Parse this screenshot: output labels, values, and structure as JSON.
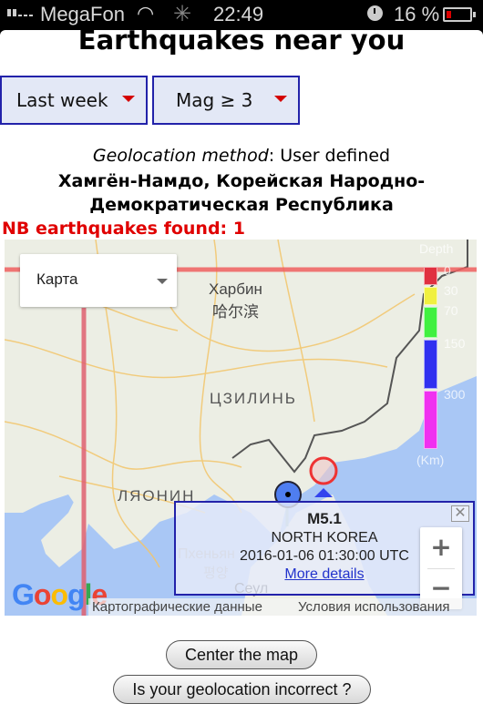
{
  "status_bar": {
    "carrier": "MegaFon",
    "time": "22:49",
    "battery": "16 %",
    "icons": [
      "signal-icon",
      "wifi-icon",
      "activity-spinner-icon",
      "alarm-clock-icon",
      "battery-icon"
    ]
  },
  "header": {
    "title": "Earthquakes near you"
  },
  "filters": {
    "period": {
      "selected": "Last week"
    },
    "magnitude": {
      "selected": "Mag ≥ 3"
    },
    "arrow_color": "#d40000"
  },
  "geolocation": {
    "method_label": "Geolocation method",
    "method_value": ": User defined",
    "place_line1": "Хамгён-Намдо, Корейская Народно-",
    "place_line2": "Демократическая Республика"
  },
  "results": {
    "count_text": "NB earthquakes found: 1",
    "color": "#e00000"
  },
  "map": {
    "type_selector": "Карта",
    "labels": {
      "harbin_ru": "Харбин",
      "harbin_zh": "哈尔滨",
      "jilin": "ЦЗИЛИНЬ",
      "liaoning": "ЛЯОНИН",
      "pyongyang_ru": "Пхеньян",
      "pyongyang_ko": "평양",
      "seoul": "Сеул"
    },
    "depth_legend": {
      "title": "Depth",
      "unit": "(Km)",
      "ticks": [
        "0",
        "30",
        "70",
        "150",
        "300"
      ],
      "colors": [
        "#e03040",
        "#f0f040",
        "#40f040",
        "#3030f0",
        "#f030f0"
      ]
    },
    "popup": {
      "magnitude": "M5.1",
      "place": "NORTH KOREA",
      "datetime": "2016-01-06 01:30:00 UTC",
      "link": "More details",
      "close": "✕"
    },
    "zoom_in": "+",
    "zoom_out": "−",
    "logo": [
      "G",
      "o",
      "o",
      "g",
      "l",
      "e"
    ],
    "logo_colors": [
      "#4285f4",
      "#ea4335",
      "#fbbc05",
      "#4285f4",
      "#34a853",
      "#ea4335"
    ],
    "attribution_data": "Картографические данные",
    "attribution_terms": "Условия использования"
  },
  "buttons": {
    "center_map": "Center the map",
    "geolocation_incorrect": "Is your geolocation incorrect ?"
  }
}
